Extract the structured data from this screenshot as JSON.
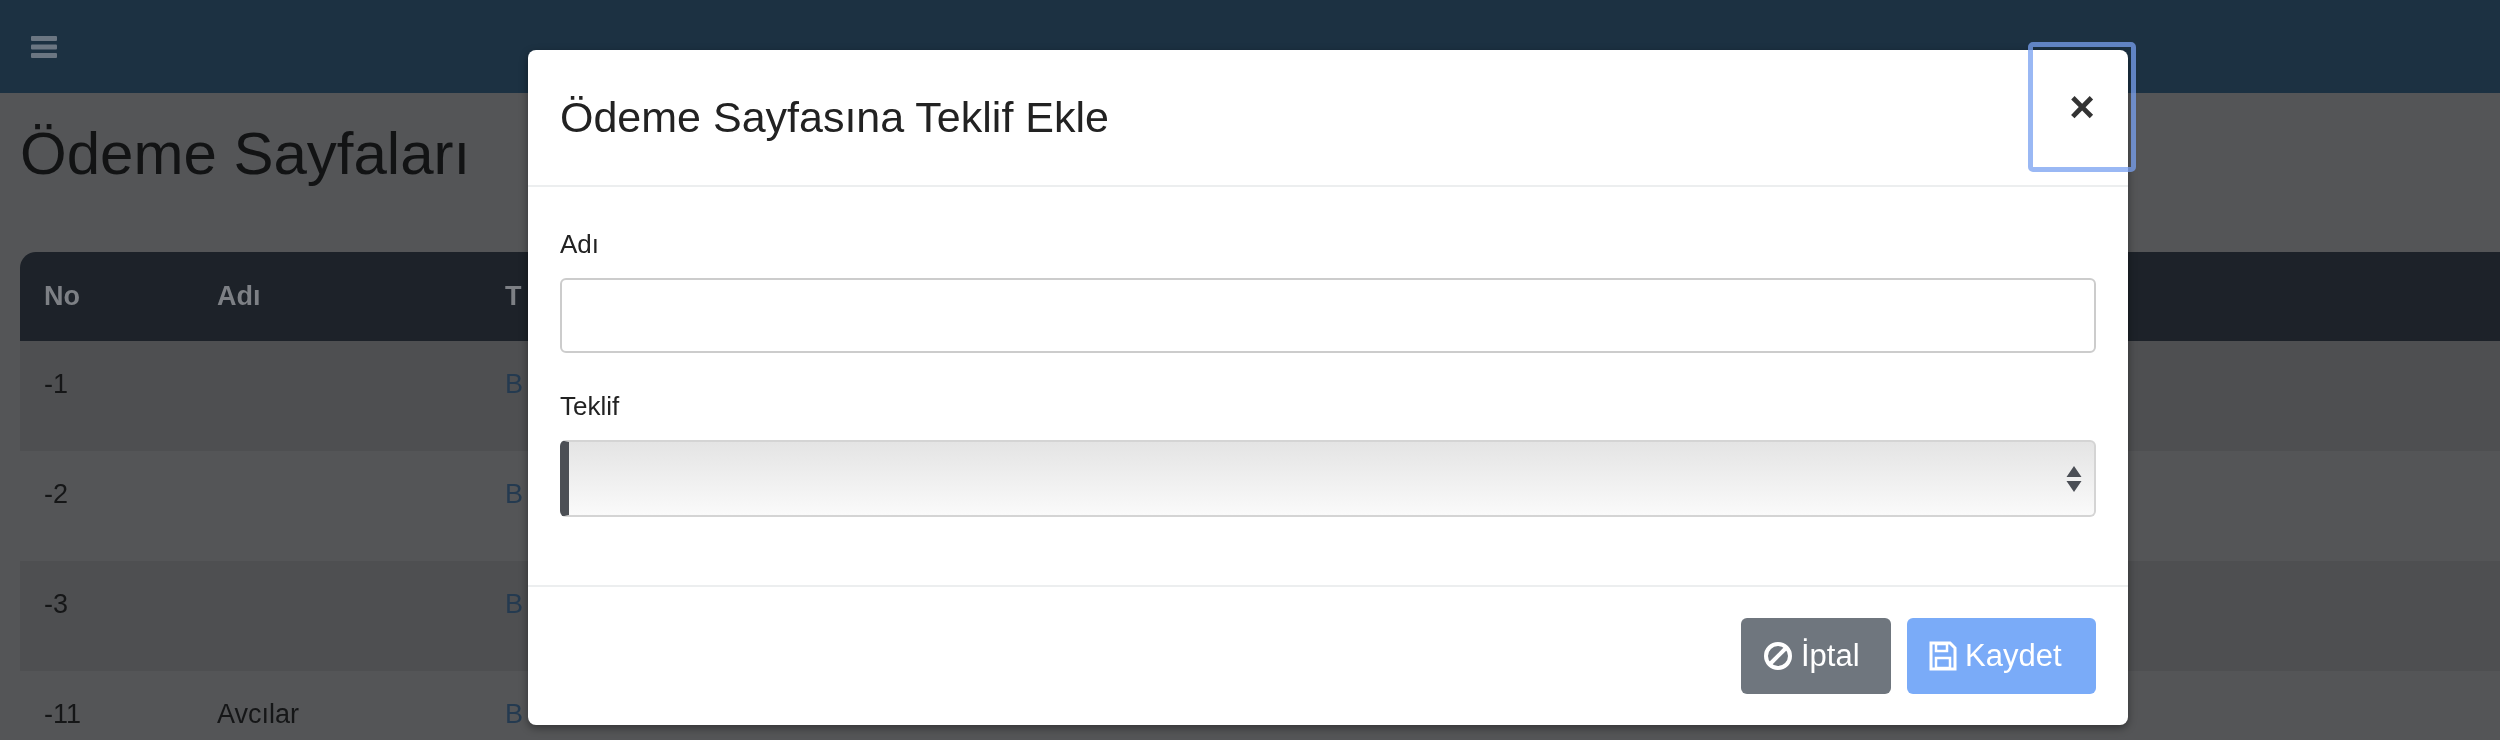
{
  "page_title": "Ödeme Sayfaları",
  "table": {
    "columns": [
      "No",
      "Adı",
      "T"
    ],
    "rows": [
      {
        "cells": [
          "-1",
          "",
          "B"
        ]
      },
      {
        "cells": [
          "-2",
          "",
          "B"
        ]
      },
      {
        "cells": [
          "-3",
          "",
          "B"
        ]
      },
      {
        "cells": [
          "-11",
          "Avcılar",
          "B"
        ]
      }
    ]
  },
  "modal": {
    "title": "Ödeme Sayfasına Teklif Ekle",
    "close": {
      "label": "×",
      "focused": true
    },
    "fields": [
      {
        "kind": "text",
        "label": "Adı"
      },
      {
        "kind": "select",
        "label": "Teklif"
      }
    ],
    "buttons": [
      {
        "kind": "cancel",
        "label": "İptal",
        "disabled": false
      },
      {
        "kind": "save",
        "label": "Kaydet",
        "disabled": true
      }
    ]
  }
}
